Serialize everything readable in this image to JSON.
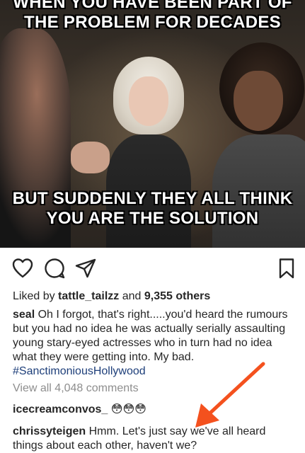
{
  "meme": {
    "top_text": "WHEN YOU HAVE BEEN PART OF THE PROBLEM FOR DECADES",
    "bottom_text_line1": "BUT SUDDENLY THEY ALL THINK",
    "bottom_text_line2": "YOU ARE THE SOLUTION"
  },
  "actions": {
    "like_icon": "heart-icon",
    "comment_icon": "comment-bubble-icon",
    "share_icon": "paper-plane-icon",
    "save_icon": "bookmark-icon"
  },
  "likes": {
    "prefix": "Liked by ",
    "user": "tattle_tailzz",
    "middle": " and ",
    "count": "9,355 others"
  },
  "caption": {
    "user": "seal",
    "text": " Oh I forgot, that's right.....you'd heard the rumours but you had no idea he was actually serially assaulting young stary-eyed actresses who in turn had no idea what they were getting into. My bad.",
    "hashtag": "#SanctimoniousHollywood"
  },
  "view_all_comments": "View all 4,048 comments",
  "comments": [
    {
      "user": "icecreamconvos_",
      "text": " 😳😳😳"
    },
    {
      "user": "chrissyteigen",
      "text": " Hmm. Let's just say we've all heard things about each other, haven't we?"
    }
  ],
  "colors": {
    "annotation_arrow": "#f4511e",
    "hashtag": "#1e3f7a",
    "muted": "#8e8e8e",
    "text": "#262626"
  }
}
